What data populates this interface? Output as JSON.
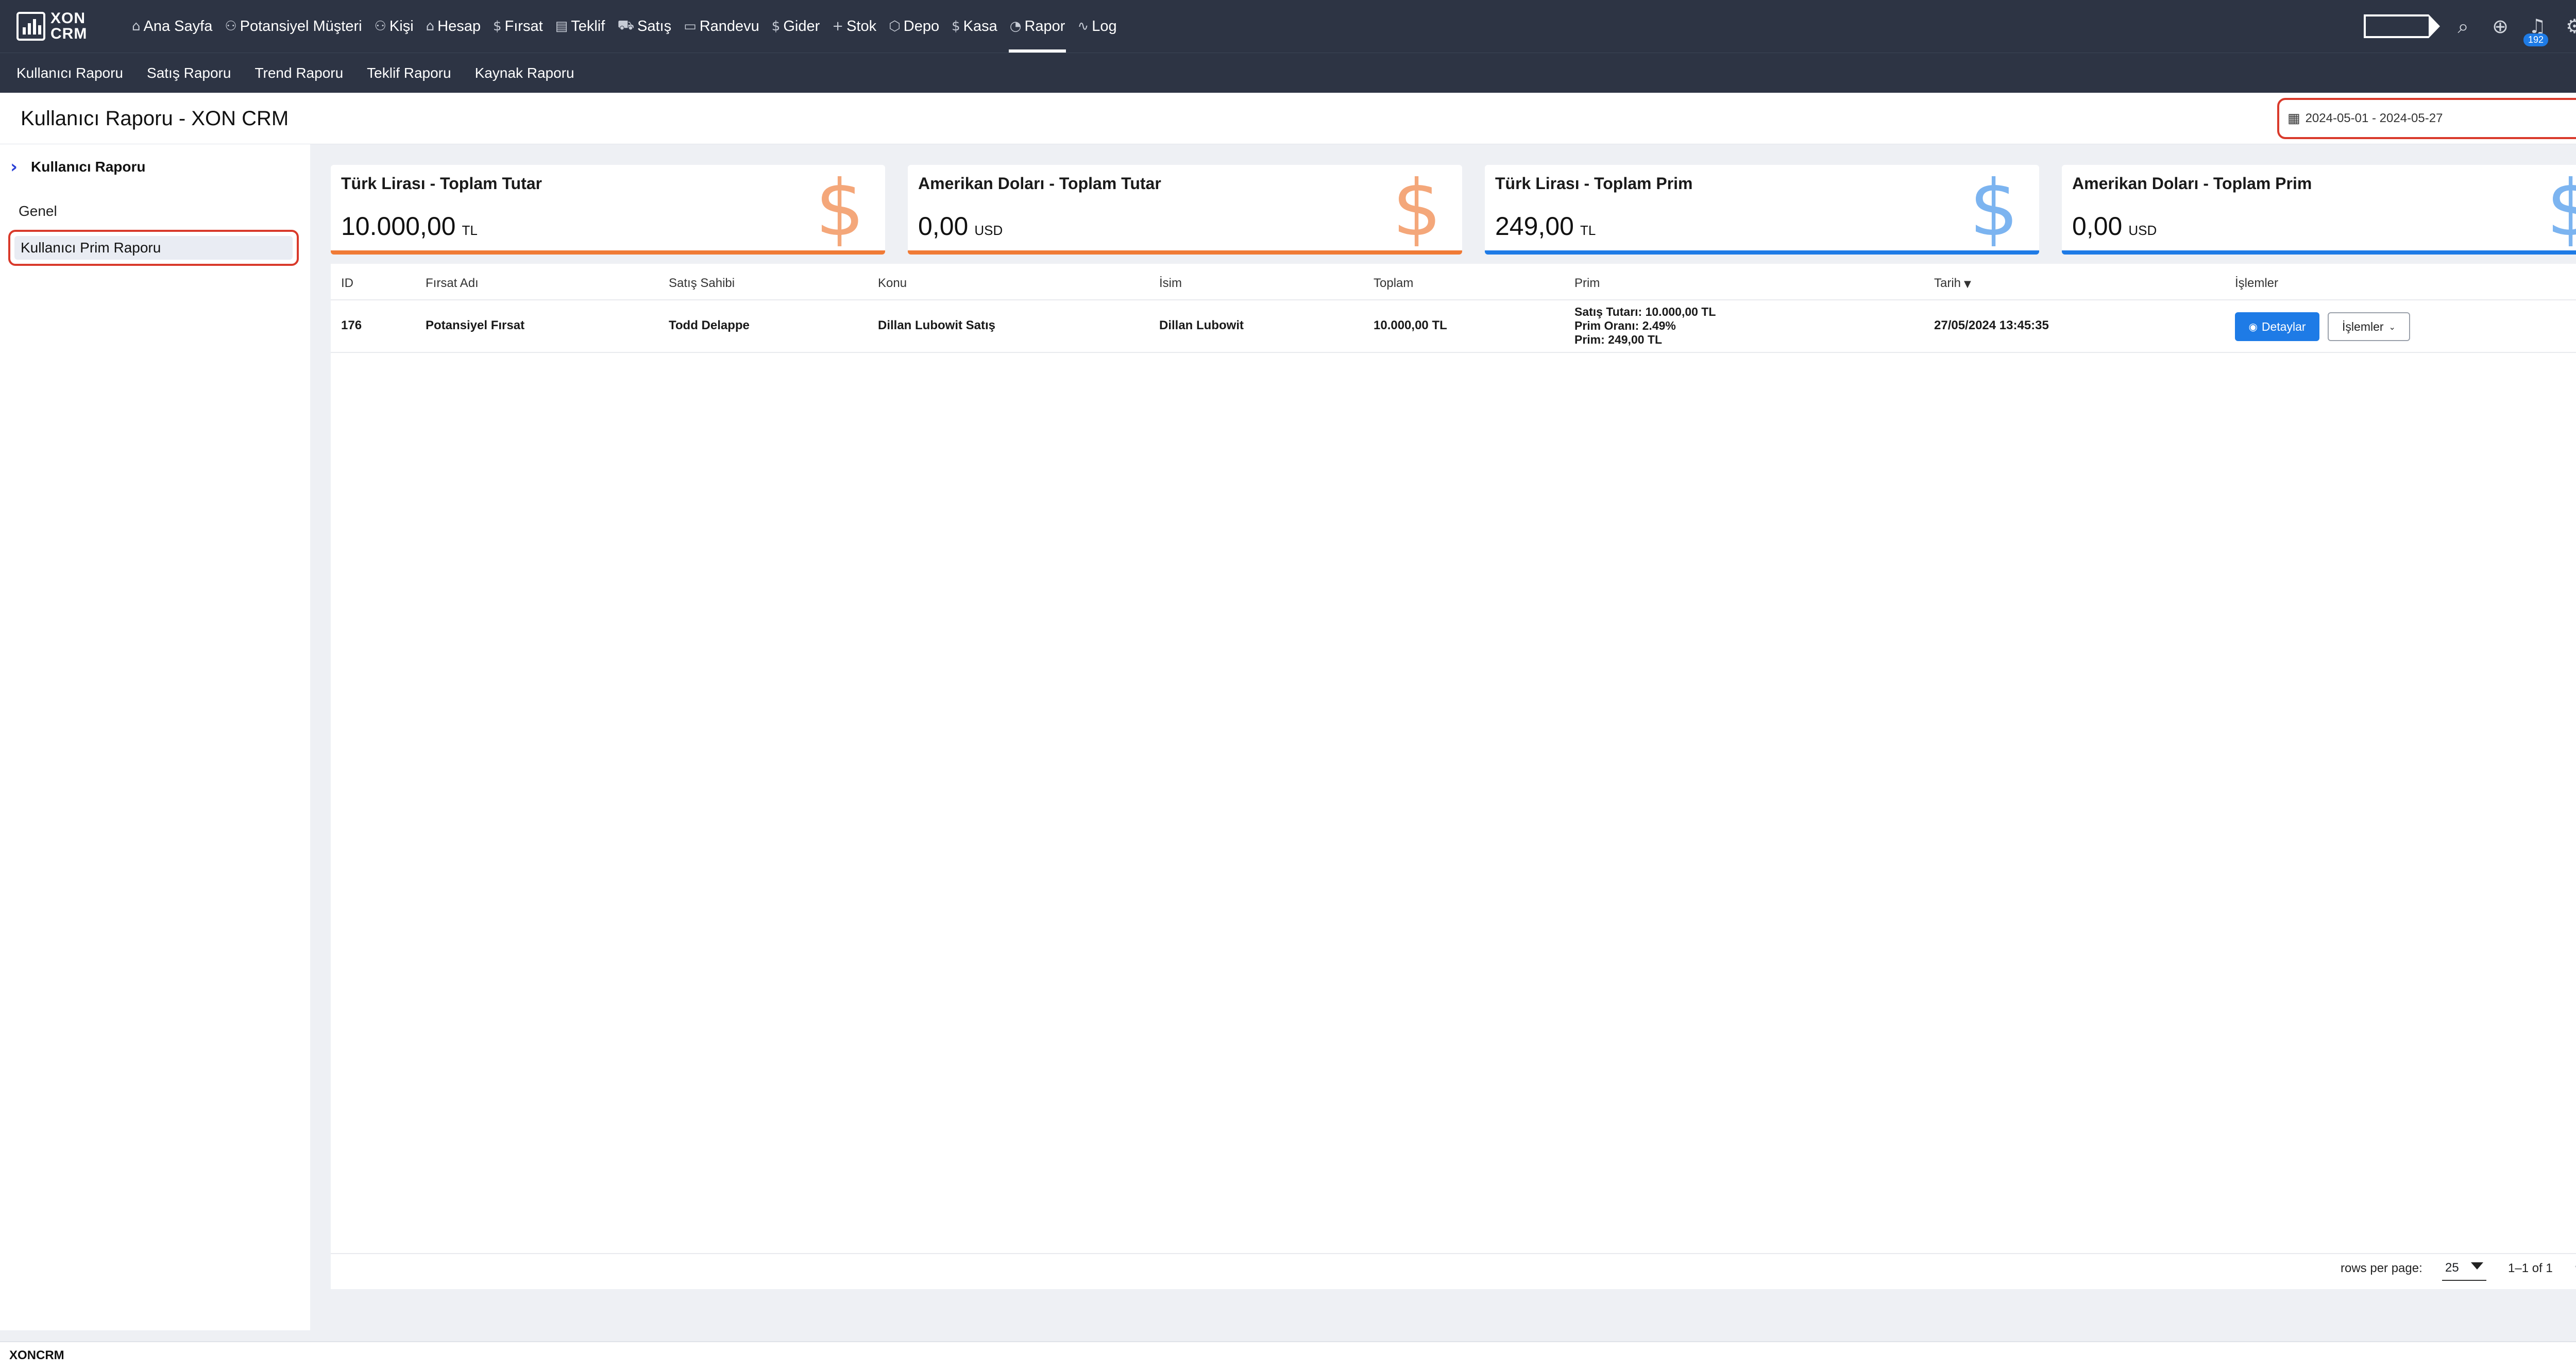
{
  "app": {
    "logo_text_1": "XON",
    "logo_text_2": "CRM",
    "footer_brand": "XONCRM"
  },
  "nav": {
    "items": [
      {
        "label": "Ana Sayfa",
        "icon": "home-icon",
        "glyph": "⌂"
      },
      {
        "label": "Potansiyel Müşteri",
        "icon": "user-icon",
        "glyph": "⚇"
      },
      {
        "label": "Kişi",
        "icon": "users-icon",
        "glyph": "⚇"
      },
      {
        "label": "Hesap",
        "icon": "building-icon",
        "glyph": "⌂"
      },
      {
        "label": "Fırsat",
        "icon": "dollar-icon",
        "glyph": "$"
      },
      {
        "label": "Teklif",
        "icon": "document-icon",
        "glyph": "▤"
      },
      {
        "label": "Satış",
        "icon": "cart-icon",
        "glyph": "⛟"
      },
      {
        "label": "Randevu",
        "icon": "calendar-icon",
        "glyph": "▭"
      },
      {
        "label": "Gider",
        "icon": "dollar-icon",
        "glyph": "$"
      },
      {
        "label": "Stok",
        "icon": "plus-icon",
        "glyph": "+"
      },
      {
        "label": "Depo",
        "icon": "box-icon",
        "glyph": "⬡"
      },
      {
        "label": "Kasa",
        "icon": "dollar-icon",
        "glyph": "$"
      },
      {
        "label": "Rapor",
        "icon": "chart-pie-icon",
        "glyph": "◔"
      },
      {
        "label": "Log",
        "icon": "activity-icon",
        "glyph": "∿"
      }
    ],
    "active": "Rapor",
    "notification_count": "192"
  },
  "subnav": {
    "items": [
      "Kullanıcı Raporu",
      "Satış Raporu",
      "Trend Raporu",
      "Teklif Raporu",
      "Kaynak Raporu"
    ]
  },
  "header": {
    "title": "Kullanıcı Raporu - XON CRM",
    "date_range": "2024-05-01 - 2024-05-27"
  },
  "sidebar": {
    "heading": "Kullanıcı Raporu",
    "items": [
      "Genel",
      "Kullanıcı Prim Raporu"
    ],
    "active": "Kullanıcı Prim Raporu"
  },
  "cards": [
    {
      "title": "Türk Lirası - Toplam Tutar",
      "value": "10.000,00",
      "unit": "TL",
      "color": "#f07b36",
      "icon_color": "#f4a77a"
    },
    {
      "title": "Amerikan Doları - Toplam Tutar",
      "value": "0,00",
      "unit": "USD",
      "color": "#f07b36",
      "icon_color": "#f4a77a"
    },
    {
      "title": "Türk Lirası - Toplam Prim",
      "value": "249,00",
      "unit": "TL",
      "color": "#1e7be6",
      "icon_color": "#7cb4f0"
    },
    {
      "title": "Amerikan Doları - Toplam Prim",
      "value": "0,00",
      "unit": "USD",
      "color": "#1e7be6",
      "icon_color": "#7cb4f0"
    }
  ],
  "table": {
    "columns": [
      "ID",
      "Fırsat Adı",
      "Satış Sahibi",
      "Konu",
      "İsim",
      "Toplam",
      "Prim",
      "Tarih",
      "İşlemler"
    ],
    "rows": [
      {
        "id": "176",
        "firsat_adi": "Potansiyel Fırsat",
        "satis_sahibi": "Todd Delappe",
        "konu": "Dillan Lubowit Satış",
        "isim": "Dillan Lubowit",
        "toplam": "10.000,00 TL",
        "prim_lines": [
          "Satış Tutarı: 10.000,00 TL",
          "Prim Oranı: 2.49%",
          "Prim: 249,00 TL"
        ],
        "tarih": "27/05/2024 13:45:35",
        "detail_label": "Detaylar",
        "actions_label": "İşlemler"
      }
    ]
  },
  "pagination": {
    "rows_label": "rows per page:",
    "rows_value": "25",
    "range": "1–1 of 1"
  }
}
